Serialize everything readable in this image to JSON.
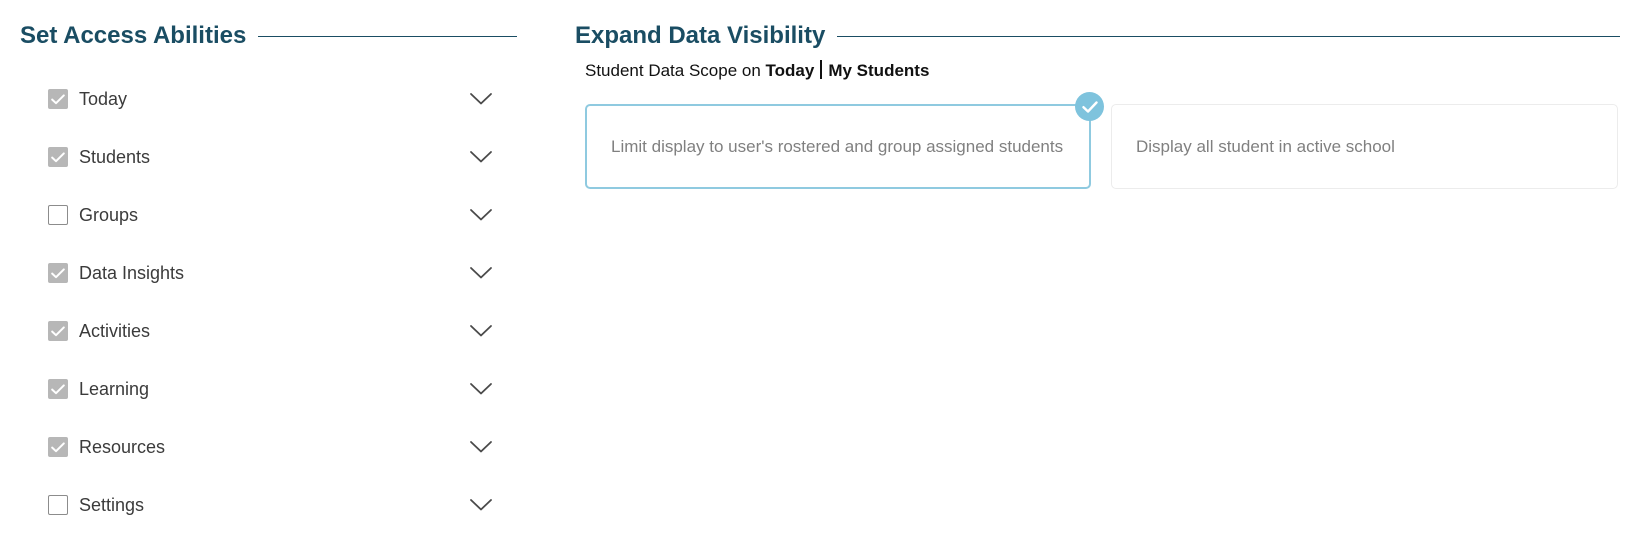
{
  "access": {
    "title": "Set Access Abilities",
    "items": [
      {
        "label": "Today",
        "checked": true
      },
      {
        "label": "Students",
        "checked": true
      },
      {
        "label": "Groups",
        "checked": false
      },
      {
        "label": "Data Insights",
        "checked": true
      },
      {
        "label": "Activities",
        "checked": true
      },
      {
        "label": "Learning",
        "checked": true
      },
      {
        "label": "Resources",
        "checked": true
      },
      {
        "label": "Settings",
        "checked": false
      }
    ],
    "expand_icon": "chevron-down-icon",
    "check_icon": "checkmark-icon"
  },
  "visibility": {
    "title": "Expand Data Visibility",
    "scope_prefix": "Student Data Scope on",
    "scope_section": "Today",
    "scope_value": "My Students",
    "options": [
      {
        "label": "Limit display to user's rostered and group assigned students",
        "selected": true
      },
      {
        "label": "Display all student in active school",
        "selected": false
      }
    ],
    "selected_icon": "check-circle-icon"
  },
  "colors": {
    "heading": "#1a4d63",
    "selected_border": "#8fcae0",
    "selected_badge": "#7ec3dd",
    "checkbox_checked": "#b7b7b7"
  }
}
